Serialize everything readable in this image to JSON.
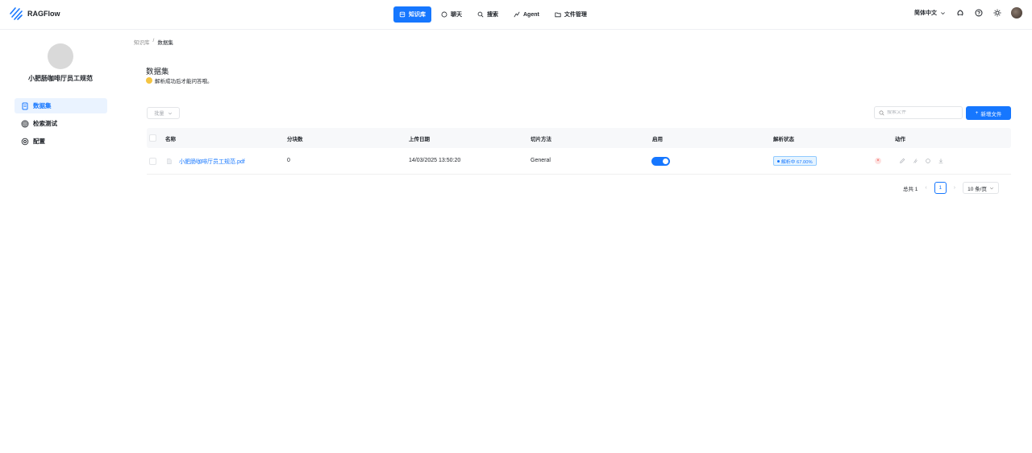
{
  "header": {
    "app_name": "RAGFlow",
    "nav": [
      {
        "label": "知识库",
        "icon": "database-icon",
        "active": true
      },
      {
        "label": "聊天",
        "icon": "chat-icon",
        "active": false
      },
      {
        "label": "搜索",
        "icon": "search-icon",
        "active": false
      },
      {
        "label": "Agent",
        "icon": "agent-icon",
        "active": false
      },
      {
        "label": "文件管理",
        "icon": "folder-icon",
        "active": false
      }
    ],
    "language": "简体中文",
    "icons": [
      "github-icon",
      "help-icon",
      "theme-icon",
      "avatar"
    ]
  },
  "sidebar": {
    "kb_name": "小肥肠咖啡厅员工规范",
    "items": [
      {
        "label": "数据集",
        "icon": "file-icon",
        "active": true
      },
      {
        "label": "检索测试",
        "icon": "target-icon",
        "active": false
      },
      {
        "label": "配置",
        "icon": "settings-icon",
        "active": false
      }
    ]
  },
  "breadcrumb": {
    "root": "知识库",
    "current": "数据集"
  },
  "page": {
    "title": "数据集",
    "tip": "解析成功后才能问答哦。"
  },
  "toolbar": {
    "bulk_label": "批量",
    "search_placeholder": "搜索文件",
    "add_label": "新增文件"
  },
  "table": {
    "columns": [
      "名称",
      "分块数",
      "上传日期",
      "切片方法",
      "启用",
      "解析状态",
      "动作"
    ],
    "rows": [
      {
        "name": "小肥肠咖啡厅员工规范.pdf",
        "chunks": "0",
        "upload_date": "14/03/2025 13:50:20",
        "method": "General",
        "enabled": true,
        "status": "解析中 67.00%"
      }
    ]
  },
  "pagination": {
    "total": "总共 1",
    "current_page": "1",
    "page_size": "10 条/页"
  },
  "colors": {
    "accent": "#1677ff",
    "danger": "#f0443c"
  }
}
